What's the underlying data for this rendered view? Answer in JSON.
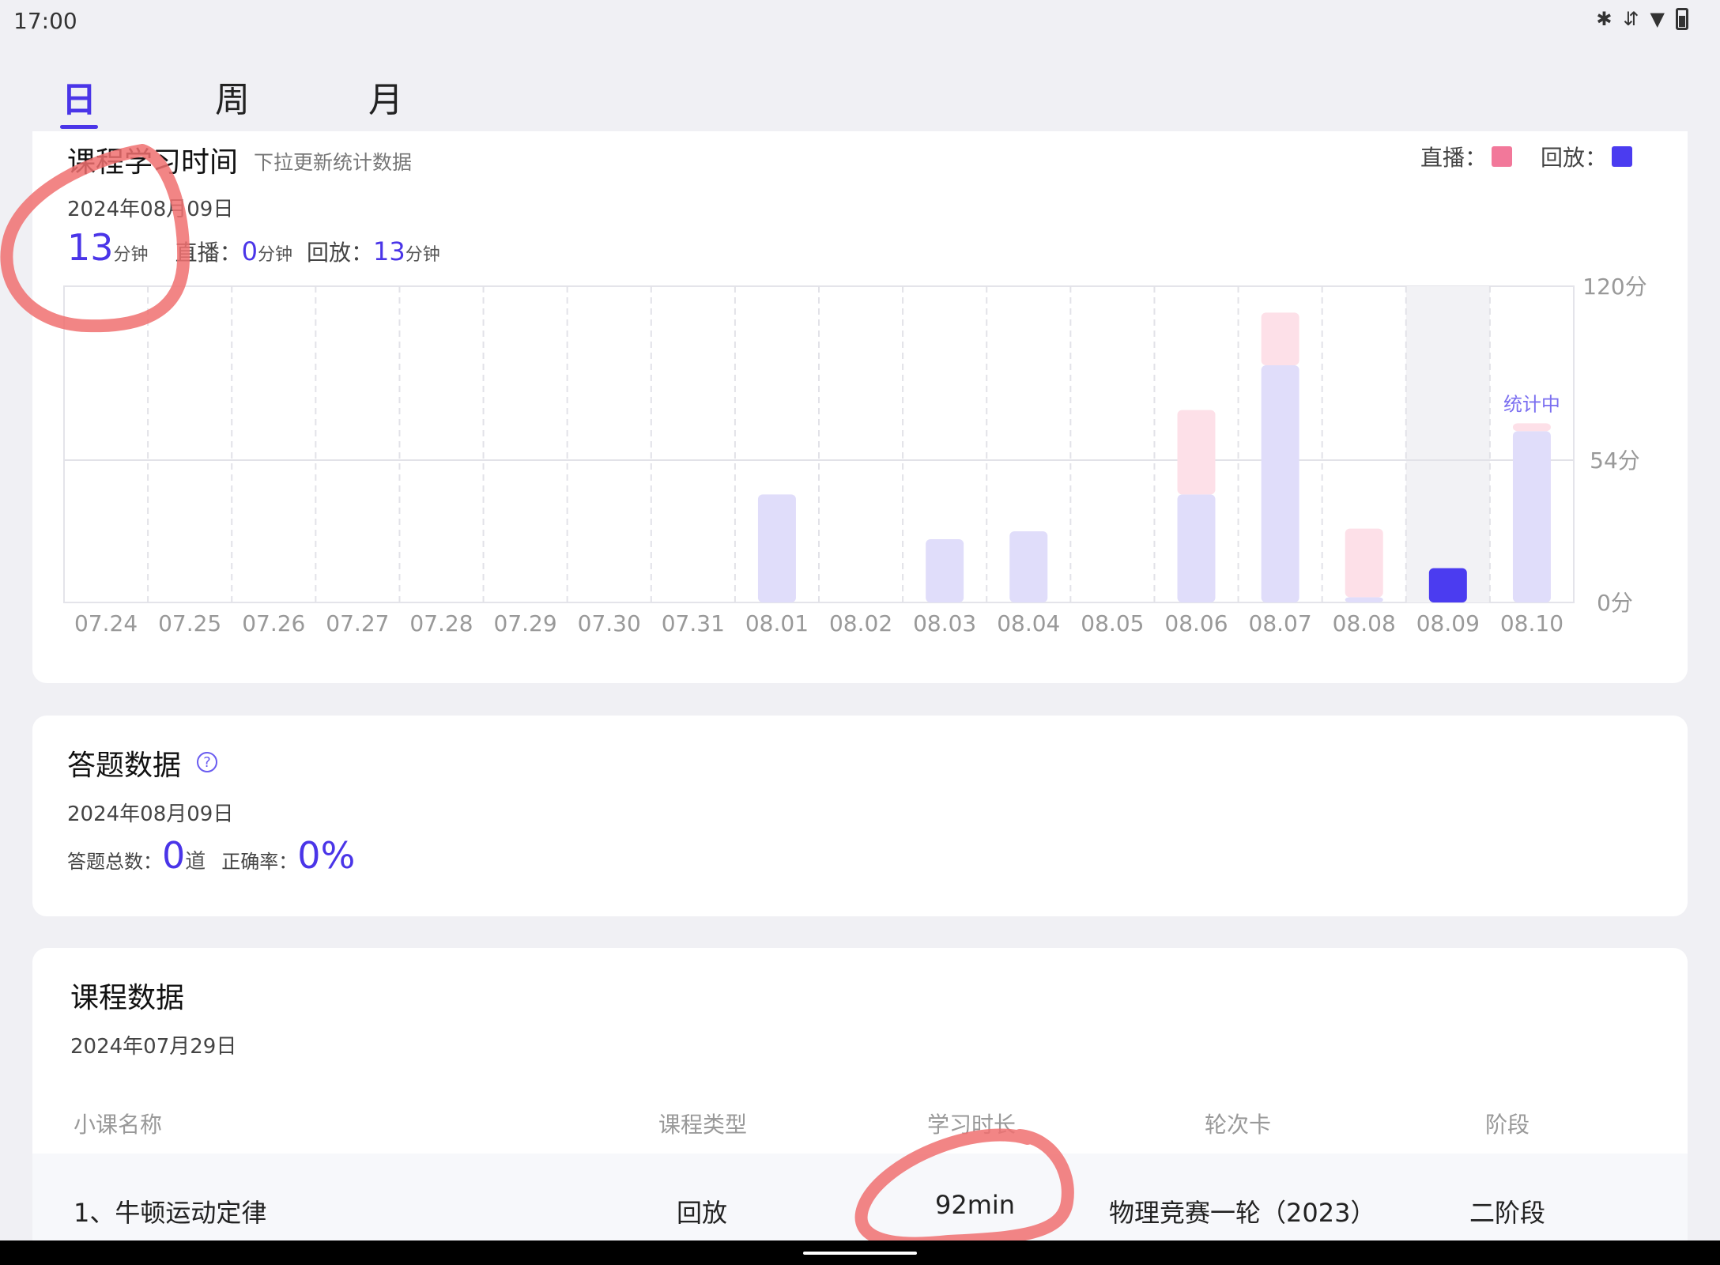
{
  "status_bar": {
    "time": "17:00",
    "icons": [
      "bluetooth-icon",
      "data-arrows-icon",
      "wifi-icon",
      "battery-icon"
    ]
  },
  "tabs": [
    {
      "label": "日",
      "active": true
    },
    {
      "label": "周",
      "active": false
    },
    {
      "label": "月",
      "active": false
    }
  ],
  "study_time": {
    "title": "课程学习时间",
    "subtitle": "下拉更新统计数据",
    "date": "2024年08月09日",
    "total_value": "13",
    "total_unit": "分钟",
    "live_label": "直播：",
    "live_value": "0",
    "live_unit": "分钟",
    "replay_label": "回放：",
    "replay_value": "13",
    "replay_unit": "分钟",
    "legend_live": "直播：",
    "legend_replay": "回放：",
    "colors": {
      "live": "#f2789a",
      "replay": "#4b3cf0"
    }
  },
  "chart_data": {
    "type": "bar",
    "stacked": true,
    "categories": [
      "07.24",
      "07.25",
      "07.26",
      "07.27",
      "07.28",
      "07.29",
      "07.30",
      "07.31",
      "08.01",
      "08.02",
      "08.03",
      "08.04",
      "08.05",
      "08.06",
      "08.07",
      "08.08",
      "08.09",
      "08.10"
    ],
    "series": [
      {
        "name": "回放",
        "values": [
          0,
          0,
          0,
          0,
          0,
          0,
          0,
          0,
          41,
          0,
          24,
          27,
          0,
          41,
          90,
          2,
          13,
          65
        ]
      },
      {
        "name": "直播",
        "values": [
          0,
          0,
          0,
          0,
          0,
          0,
          0,
          0,
          0,
          0,
          0,
          0,
          0,
          32,
          20,
          26,
          0,
          3
        ]
      }
    ],
    "y_ticks": [
      "120分",
      "54分",
      "0分"
    ],
    "ylim": [
      0,
      120
    ],
    "selected_category": "08.09",
    "pending_label": "统计中",
    "pending_category": "08.10",
    "grid": true
  },
  "answer": {
    "title": "答题数据",
    "date": "2024年08月09日",
    "total_label": "答题总数：",
    "total_value": "0",
    "total_unit": "道",
    "rate_label": "正确率：",
    "rate_value": "0%"
  },
  "course": {
    "title": "课程数据",
    "date": "2024年07月29日",
    "headers": [
      "小课名称",
      "课程类型",
      "学习时长",
      "轮次卡",
      "阶段"
    ],
    "rows": [
      {
        "name": "1、牛顿运动定律",
        "type": "回放",
        "duration": "92min",
        "round": "物理竞赛一轮（2023）",
        "stage": "二阶段"
      }
    ]
  }
}
